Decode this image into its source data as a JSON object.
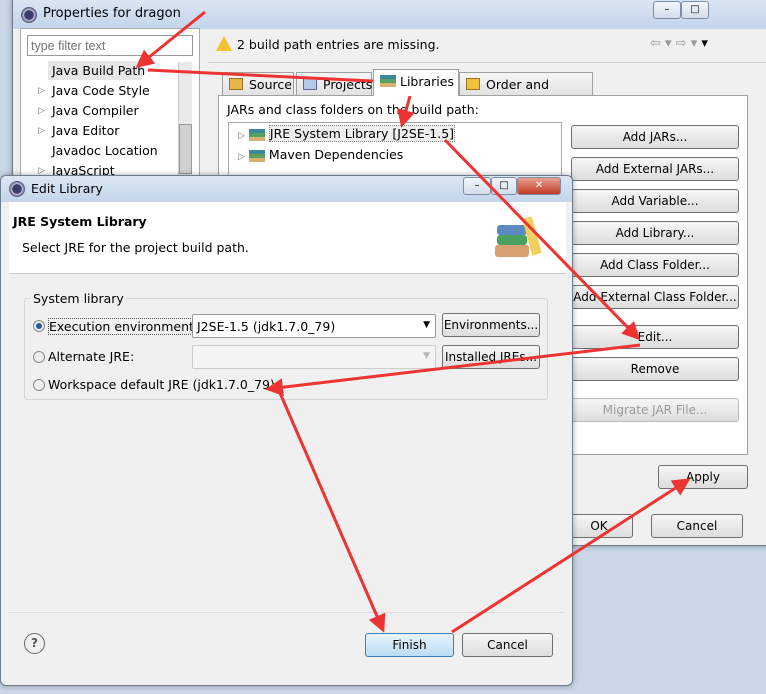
{
  "properties": {
    "title": "Properties for dragon",
    "filter_placeholder": "type filter text",
    "tree": [
      "Java Build Path",
      "Java Code Style",
      "Java Compiler",
      "Java Editor",
      "Javadoc Location",
      "JavaScript"
    ],
    "warning": "2 build path entries are missing.",
    "tabs": [
      "Source",
      "Projects",
      "Libraries",
      "Order and Export"
    ],
    "list_label": "JARs and class folders on the build path:",
    "entries": [
      "JRE System Library [J2SE-1.5]",
      "Maven Dependencies"
    ],
    "buttons": [
      "Add JARs...",
      "Add External JARs...",
      "Add Variable...",
      "Add Library...",
      "Add Class Folder...",
      "Add External Class Folder...",
      "Edit...",
      "Remove",
      "Migrate JAR File..."
    ],
    "apply": "Apply",
    "ok": "OK",
    "cancel": "Cancel"
  },
  "edit_library": {
    "title": "Edit Library",
    "heading": "JRE System Library",
    "description": "Select JRE for the project build path.",
    "group_label": "System library",
    "exec_env_label": "Execution environment:",
    "exec_env_value": "J2SE-1.5 (jdk1.7.0_79)",
    "environments_button": "Environments...",
    "alt_jre_label": "Alternate JRE:",
    "installed_jres_button": "Installed JREs...",
    "workspace_label": "Workspace default JRE (jdk1.7.0_79)",
    "selected": "Execution environment",
    "help": "?",
    "finish": "Finish",
    "cancel": "Cancel"
  },
  "colors": {
    "annotation_arrow": "#ee3333"
  }
}
